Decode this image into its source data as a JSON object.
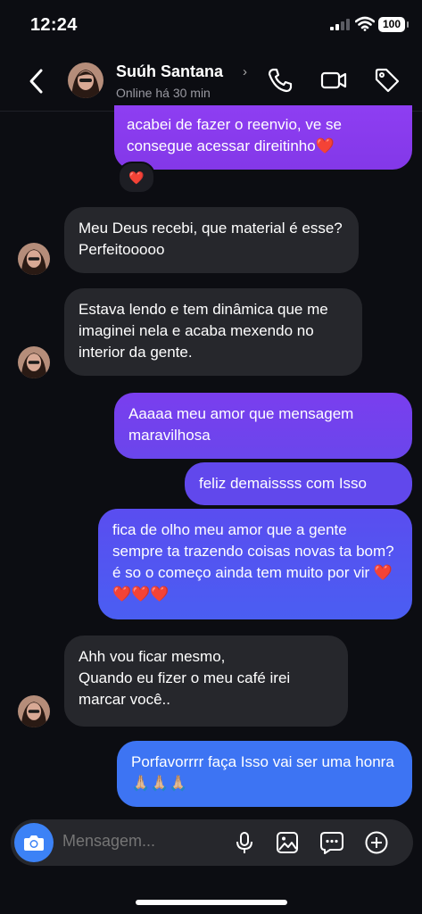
{
  "status": {
    "time": "12:24",
    "battery": "100"
  },
  "header": {
    "name": "Suúh Santana",
    "presence": "Online há 30 min"
  },
  "messages": [
    {
      "from": "me",
      "text": "acabei de fazer o reenvio, ve se consegue acessar direitinho❤️"
    },
    {
      "from": "them",
      "text": "Meu Deus recebi, que material é esse? Perfeitooooo"
    },
    {
      "from": "them",
      "text": "Estava lendo e tem dinâmica que me imaginei nela e acaba mexendo no interior da gente."
    },
    {
      "from": "me",
      "text": "Aaaaa meu amor que mensagem maravilhosa"
    },
    {
      "from": "me",
      "text": "feliz demaissss com Isso"
    },
    {
      "from": "me",
      "text": "fica de olho meu amor que a gente sempre ta trazendo coisas novas ta bom? é so o começo ainda tem muito por vir ❤️❤️❤️❤️"
    },
    {
      "from": "them",
      "text": "Ahh vou ficar mesmo,\nQuando eu fizer o meu café irei marcar você.."
    },
    {
      "from": "me",
      "text": "Porfavorrrr faça Isso vai ser uma honra 🙏🏼🙏🏼🙏🏼"
    }
  ],
  "reaction": "❤️",
  "composer": {
    "placeholder": "Mensagem..."
  },
  "icons": {
    "back": "chevron-left-icon",
    "call": "phone-icon",
    "video": "video-camera-icon",
    "tag": "tag-icon",
    "camera": "camera-icon",
    "mic": "microphone-icon",
    "gallery": "image-icon",
    "sticker": "chat-bubble-icon",
    "more": "plus-circle-icon"
  },
  "colors": {
    "background": "#0c0d12",
    "incoming": "#26272c",
    "outgoing_top": "#8b3cf0",
    "outgoing_bottom": "#3c82f6",
    "accent": "#3c82f6"
  }
}
